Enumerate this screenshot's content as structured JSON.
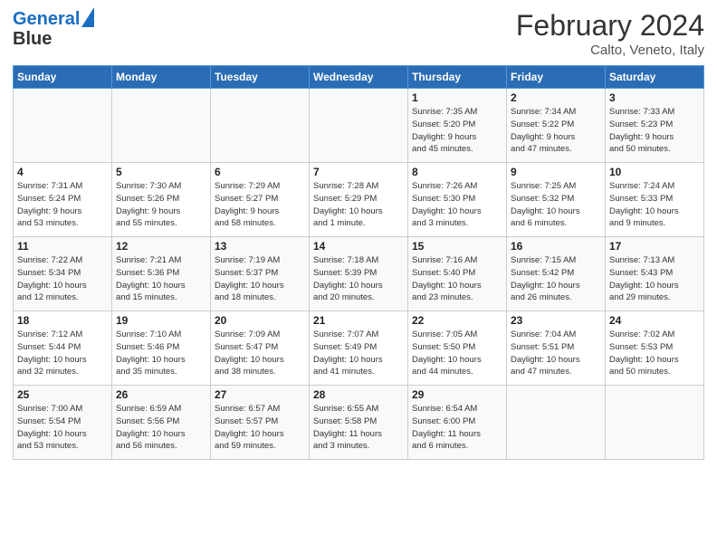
{
  "header": {
    "logo_line1": "General",
    "logo_line2": "Blue",
    "title": "February 2024",
    "subtitle": "Calto, Veneto, Italy"
  },
  "weekdays": [
    "Sunday",
    "Monday",
    "Tuesday",
    "Wednesday",
    "Thursday",
    "Friday",
    "Saturday"
  ],
  "weeks": [
    [
      {
        "day": "",
        "detail": ""
      },
      {
        "day": "",
        "detail": ""
      },
      {
        "day": "",
        "detail": ""
      },
      {
        "day": "",
        "detail": ""
      },
      {
        "day": "1",
        "detail": "Sunrise: 7:35 AM\nSunset: 5:20 PM\nDaylight: 9 hours\nand 45 minutes."
      },
      {
        "day": "2",
        "detail": "Sunrise: 7:34 AM\nSunset: 5:22 PM\nDaylight: 9 hours\nand 47 minutes."
      },
      {
        "day": "3",
        "detail": "Sunrise: 7:33 AM\nSunset: 5:23 PM\nDaylight: 9 hours\nand 50 minutes."
      }
    ],
    [
      {
        "day": "4",
        "detail": "Sunrise: 7:31 AM\nSunset: 5:24 PM\nDaylight: 9 hours\nand 53 minutes."
      },
      {
        "day": "5",
        "detail": "Sunrise: 7:30 AM\nSunset: 5:26 PM\nDaylight: 9 hours\nand 55 minutes."
      },
      {
        "day": "6",
        "detail": "Sunrise: 7:29 AM\nSunset: 5:27 PM\nDaylight: 9 hours\nand 58 minutes."
      },
      {
        "day": "7",
        "detail": "Sunrise: 7:28 AM\nSunset: 5:29 PM\nDaylight: 10 hours\nand 1 minute."
      },
      {
        "day": "8",
        "detail": "Sunrise: 7:26 AM\nSunset: 5:30 PM\nDaylight: 10 hours\nand 3 minutes."
      },
      {
        "day": "9",
        "detail": "Sunrise: 7:25 AM\nSunset: 5:32 PM\nDaylight: 10 hours\nand 6 minutes."
      },
      {
        "day": "10",
        "detail": "Sunrise: 7:24 AM\nSunset: 5:33 PM\nDaylight: 10 hours\nand 9 minutes."
      }
    ],
    [
      {
        "day": "11",
        "detail": "Sunrise: 7:22 AM\nSunset: 5:34 PM\nDaylight: 10 hours\nand 12 minutes."
      },
      {
        "day": "12",
        "detail": "Sunrise: 7:21 AM\nSunset: 5:36 PM\nDaylight: 10 hours\nand 15 minutes."
      },
      {
        "day": "13",
        "detail": "Sunrise: 7:19 AM\nSunset: 5:37 PM\nDaylight: 10 hours\nand 18 minutes."
      },
      {
        "day": "14",
        "detail": "Sunrise: 7:18 AM\nSunset: 5:39 PM\nDaylight: 10 hours\nand 20 minutes."
      },
      {
        "day": "15",
        "detail": "Sunrise: 7:16 AM\nSunset: 5:40 PM\nDaylight: 10 hours\nand 23 minutes."
      },
      {
        "day": "16",
        "detail": "Sunrise: 7:15 AM\nSunset: 5:42 PM\nDaylight: 10 hours\nand 26 minutes."
      },
      {
        "day": "17",
        "detail": "Sunrise: 7:13 AM\nSunset: 5:43 PM\nDaylight: 10 hours\nand 29 minutes."
      }
    ],
    [
      {
        "day": "18",
        "detail": "Sunrise: 7:12 AM\nSunset: 5:44 PM\nDaylight: 10 hours\nand 32 minutes."
      },
      {
        "day": "19",
        "detail": "Sunrise: 7:10 AM\nSunset: 5:46 PM\nDaylight: 10 hours\nand 35 minutes."
      },
      {
        "day": "20",
        "detail": "Sunrise: 7:09 AM\nSunset: 5:47 PM\nDaylight: 10 hours\nand 38 minutes."
      },
      {
        "day": "21",
        "detail": "Sunrise: 7:07 AM\nSunset: 5:49 PM\nDaylight: 10 hours\nand 41 minutes."
      },
      {
        "day": "22",
        "detail": "Sunrise: 7:05 AM\nSunset: 5:50 PM\nDaylight: 10 hours\nand 44 minutes."
      },
      {
        "day": "23",
        "detail": "Sunrise: 7:04 AM\nSunset: 5:51 PM\nDaylight: 10 hours\nand 47 minutes."
      },
      {
        "day": "24",
        "detail": "Sunrise: 7:02 AM\nSunset: 5:53 PM\nDaylight: 10 hours\nand 50 minutes."
      }
    ],
    [
      {
        "day": "25",
        "detail": "Sunrise: 7:00 AM\nSunset: 5:54 PM\nDaylight: 10 hours\nand 53 minutes."
      },
      {
        "day": "26",
        "detail": "Sunrise: 6:59 AM\nSunset: 5:56 PM\nDaylight: 10 hours\nand 56 minutes."
      },
      {
        "day": "27",
        "detail": "Sunrise: 6:57 AM\nSunset: 5:57 PM\nDaylight: 10 hours\nand 59 minutes."
      },
      {
        "day": "28",
        "detail": "Sunrise: 6:55 AM\nSunset: 5:58 PM\nDaylight: 11 hours\nand 3 minutes."
      },
      {
        "day": "29",
        "detail": "Sunrise: 6:54 AM\nSunset: 6:00 PM\nDaylight: 11 hours\nand 6 minutes."
      },
      {
        "day": "",
        "detail": ""
      },
      {
        "day": "",
        "detail": ""
      }
    ]
  ]
}
